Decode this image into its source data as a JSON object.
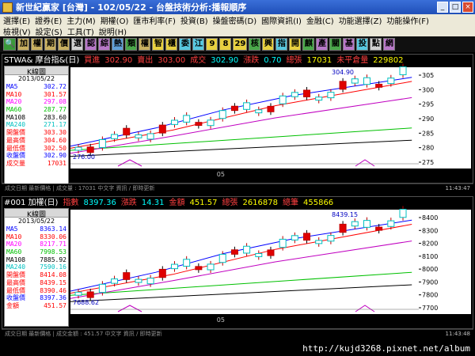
{
  "window": {
    "title": "新世紀贏家 [台灣] - 102/05/22 - 台盤技術分析:播報順序",
    "buttons": [
      "_",
      "□",
      "×"
    ]
  },
  "menu": {
    "row1": [
      "選擇(E)",
      "證券(E)",
      "主力(M)",
      "期權(O)",
      "匯市利率(F)",
      "投資(B)",
      "操盤密碼(D)",
      "國際資訊(I)",
      "金融(C)",
      "功能選擇(Z)",
      "功能操作(F)"
    ],
    "row2": [
      "檢視(V)",
      "設定(S)",
      "工具(T)",
      "說明(H)"
    ]
  },
  "toolbar": [
    "🔍",
    "加",
    "權",
    "期",
    "價",
    "選",
    "認",
    "綜",
    "熱",
    "類",
    "權",
    "智",
    "櫃",
    "委",
    "江",
    "9",
    "8",
    "29",
    "核",
    "興",
    "指",
    "開",
    "麒",
    "產",
    "關",
    "基",
    "投",
    "點",
    "網"
  ],
  "panel1": {
    "header": [
      {
        "text": "STWA& 摩台指&(日)",
        "color": "#ffffff"
      },
      {
        "text": "買進",
        "color": "#ff4040"
      },
      {
        "text": "302.90",
        "color": "#ff4040"
      },
      {
        "text": "賣出",
        "color": "#ff4040"
      },
      {
        "text": "303.00",
        "color": "#ff4040"
      },
      {
        "text": "成交",
        "color": "#ff4040"
      },
      {
        "text": "302.90",
        "color": "#00ffff"
      },
      {
        "text": "漲跌",
        "color": "#ff4040"
      },
      {
        "text": "0.70",
        "color": "#00ffff"
      },
      {
        "text": "總張",
        "color": "#ff4040"
      },
      {
        "text": "17031",
        "color": "#ffff00"
      },
      {
        "text": "未平倉量",
        "color": "#ff4040"
      },
      {
        "text": "229802",
        "color": "#ffff00"
      }
    ],
    "legend_title": "K線圖",
    "legend_date": "2013/05/22",
    "legend": [
      {
        "label": "MA5",
        "value": "302.72",
        "color": "#0000ff"
      },
      {
        "label": "MA10",
        "value": "301.57",
        "color": "#ff0000"
      },
      {
        "label": "MA20",
        "value": "297.08",
        "color": "#ff00ff"
      },
      {
        "label": "MA60",
        "value": "287.77",
        "color": "#00c000"
      },
      {
        "label": "MA108",
        "value": "283.60",
        "color": "#000000"
      },
      {
        "label": "MA240",
        "value": "271.17",
        "color": "#00c0c0"
      },
      {
        "label": "開盤價",
        "value": "303.30",
        "color": "#ff0000"
      },
      {
        "label": "最高價",
        "value": "304.60",
        "color": "#ff0000"
      },
      {
        "label": "最低價",
        "value": "302.50",
        "color": "#ff0000"
      },
      {
        "label": "收盤價",
        "value": "302.90",
        "color": "#0000ff"
      },
      {
        "label": "成交量",
        "value": "17031",
        "color": "#ff0000"
      }
    ],
    "high_label": "304.90",
    "low_label": "276.00",
    "x_label": "05",
    "y_ticks": [
      "305",
      "300",
      "295",
      "290",
      "285",
      "280",
      "275"
    ],
    "status_text": "成交日期 最新價格 | 成交量 : 17031 中文字 資訊 / 即時更新",
    "clock": "11:43:47"
  },
  "panel2": {
    "header": [
      {
        "text": "#001 加權(日)",
        "color": "#ffffff"
      },
      {
        "text": "指數",
        "color": "#ff4040"
      },
      {
        "text": "8397.36",
        "color": "#00ffff"
      },
      {
        "text": "漲跌",
        "color": "#ff4040"
      },
      {
        "text": "14.31",
        "color": "#00ffff"
      },
      {
        "text": "金額",
        "color": "#ff4040"
      },
      {
        "text": "451.57",
        "color": "#ffff00"
      },
      {
        "text": "總張",
        "color": "#ff4040"
      },
      {
        "text": "2616878",
        "color": "#ffff00"
      },
      {
        "text": "總筆",
        "color": "#ff4040"
      },
      {
        "text": "455866",
        "color": "#ffff00"
      }
    ],
    "legend_title": "K線圖",
    "legend_date": "2013/05/22",
    "legend": [
      {
        "label": "MA5",
        "value": "8363.14",
        "color": "#0000ff"
      },
      {
        "label": "MA10",
        "value": "8330.06",
        "color": "#ff0000"
      },
      {
        "label": "MA20",
        "value": "8217.71",
        "color": "#ff00ff"
      },
      {
        "label": "MA60",
        "value": "7998.53",
        "color": "#00c000"
      },
      {
        "label": "MA108",
        "value": "7885.92",
        "color": "#000000"
      },
      {
        "label": "MA240",
        "value": "7590.16",
        "color": "#00c0c0"
      },
      {
        "label": "開盤價",
        "value": "8414.08",
        "color": "#ff0000"
      },
      {
        "label": "最高價",
        "value": "8439.15",
        "color": "#ff0000"
      },
      {
        "label": "最低價",
        "value": "8390.46",
        "color": "#ff0000"
      },
      {
        "label": "收盤價",
        "value": "8397.36",
        "color": "#0000ff"
      },
      {
        "label": "金額",
        "value": "451.57",
        "color": "#ff0000"
      }
    ],
    "high_label": "8439.15",
    "low_label": "7688.62",
    "x_label": "05",
    "y_ticks": [
      "8400",
      "8300",
      "8200",
      "8100",
      "8000",
      "7900",
      "7800",
      "7700"
    ],
    "status_text": "成交日期 最新價格 | 成交金額 : 451.57 中文字 資訊 / 即時更新",
    "clock": "11:43:48"
  },
  "bottom_url": "http://kujd3268.pixnet.net/album"
}
